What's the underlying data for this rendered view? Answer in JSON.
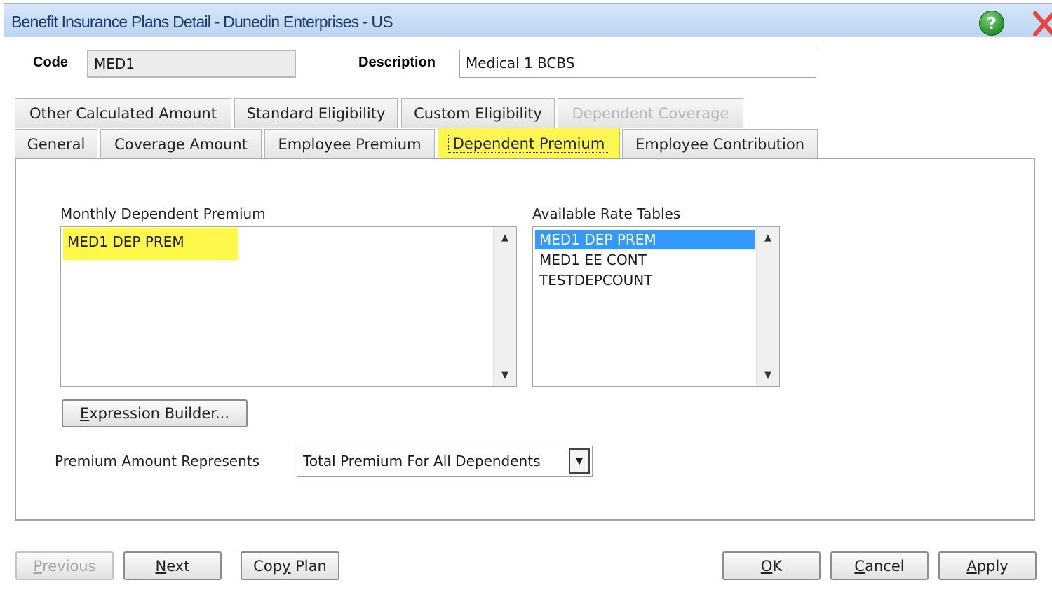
{
  "window": {
    "title": "Benefit Insurance Plans Detail - Dunedin Enterprises - US",
    "help_glyph": "?",
    "icons": [
      "help-icon",
      "close-icon"
    ]
  },
  "header": {
    "code_label": "Code",
    "code_value": "MED1",
    "description_label": "Description",
    "description_value": "Medical 1 BCBS"
  },
  "tabs_row1": [
    {
      "label": "Other Calculated Amount",
      "state": "normal"
    },
    {
      "label": "Standard Eligibility",
      "state": "normal"
    },
    {
      "label": "Custom Eligibility",
      "state": "normal"
    },
    {
      "label": "Dependent Coverage",
      "state": "disabled"
    }
  ],
  "tabs_row2": [
    {
      "label": "General",
      "state": "normal"
    },
    {
      "label": "Coverage Amount",
      "state": "normal"
    },
    {
      "label": "Employee Premium",
      "state": "normal"
    },
    {
      "label": "Dependent Premium",
      "state": "active"
    },
    {
      "label": "Employee Contribution",
      "state": "normal"
    }
  ],
  "panel": {
    "monthly_label": "Monthly Dependent Premium",
    "monthly_items": [
      "MED1 DEP PREM"
    ],
    "available_label": "Available Rate Tables",
    "available_items": [
      "MED1 DEP PREM",
      "MED1 EE CONT",
      "TESTDEPCOUNT"
    ],
    "available_selected": "MED1 DEP PREM",
    "expression_button": {
      "mnemonic": "E",
      "rest": "xpression Builder..."
    },
    "premium_represents_label": "Premium Amount Represents",
    "premium_represents_value": "Total Premium For All Dependents"
  },
  "footer": {
    "previous": {
      "mnemonic": "P",
      "rest": "revious",
      "enabled": false
    },
    "next": {
      "mnemonic": "N",
      "rest": "ext",
      "enabled": true
    },
    "copy_plan": {
      "pre": "Cop",
      "mnemonic": "y",
      "post": " Plan",
      "enabled": true
    },
    "ok": {
      "mnemonic": "O",
      "rest": "K"
    },
    "cancel": {
      "mnemonic": "C",
      "rest": "ancel"
    },
    "apply": {
      "mnemonic": "A",
      "rest": "pply"
    }
  },
  "colors": {
    "highlight_yellow": "#fff74a",
    "selection_blue": "#3399ff",
    "titlebar": "#c6dbf4"
  }
}
